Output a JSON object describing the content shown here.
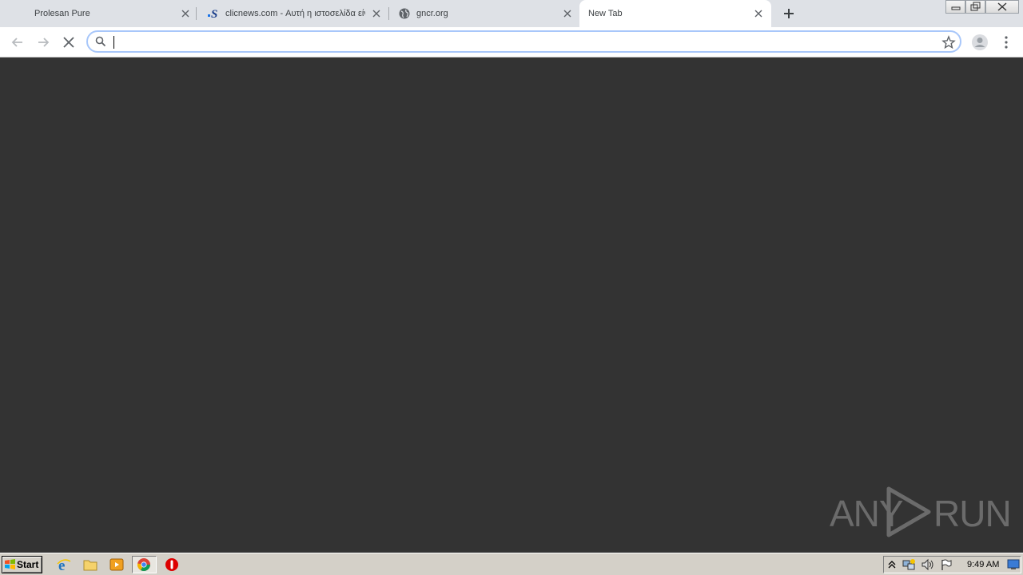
{
  "browser": {
    "tabs": [
      {
        "title": "Prolesan Pure",
        "favicon": "none",
        "active": false
      },
      {
        "title": "clicnews.com - Αυτή η ιστοσελίδα είν",
        "favicon": "clicnews-s-icon",
        "active": false
      },
      {
        "title": "gncr.org",
        "favicon": "globe-icon",
        "active": false
      },
      {
        "title": "New Tab",
        "favicon": "none",
        "active": true
      }
    ],
    "new_tab_icon": "plus-icon",
    "window_controls": [
      "minimize-icon",
      "restore-icon",
      "close-icon"
    ],
    "toolbar": {
      "back_icon": "back-arrow-icon",
      "forward_icon": "forward-arrow-icon",
      "stop_icon": "stop-loading-icon",
      "search_icon": "search-icon",
      "bookmark_icon": "star-icon",
      "profile_icon": "profile-avatar-icon",
      "menu_icon": "kebab-menu-icon"
    },
    "omnibox": {
      "value": "",
      "placeholder": ""
    }
  },
  "content": {
    "background": "#333333"
  },
  "watermark": {
    "left": "ANY",
    "right": "RUN"
  },
  "taskbar": {
    "start_label": "Start",
    "pinned": [
      "ie-icon",
      "folder-icon",
      "media-player-icon",
      "chrome-icon",
      "opera-icon"
    ],
    "tray_icons": [
      "tray-chevron-icon",
      "network-icon",
      "volume-icon",
      "flag-icon",
      "show-desktop-icon"
    ],
    "clock": "9:49 AM"
  },
  "colors": {
    "tabstrip": "#dee1e6",
    "content": "#333333",
    "taskbar": "#d4d0c8",
    "accent": "#a8c7fa"
  }
}
